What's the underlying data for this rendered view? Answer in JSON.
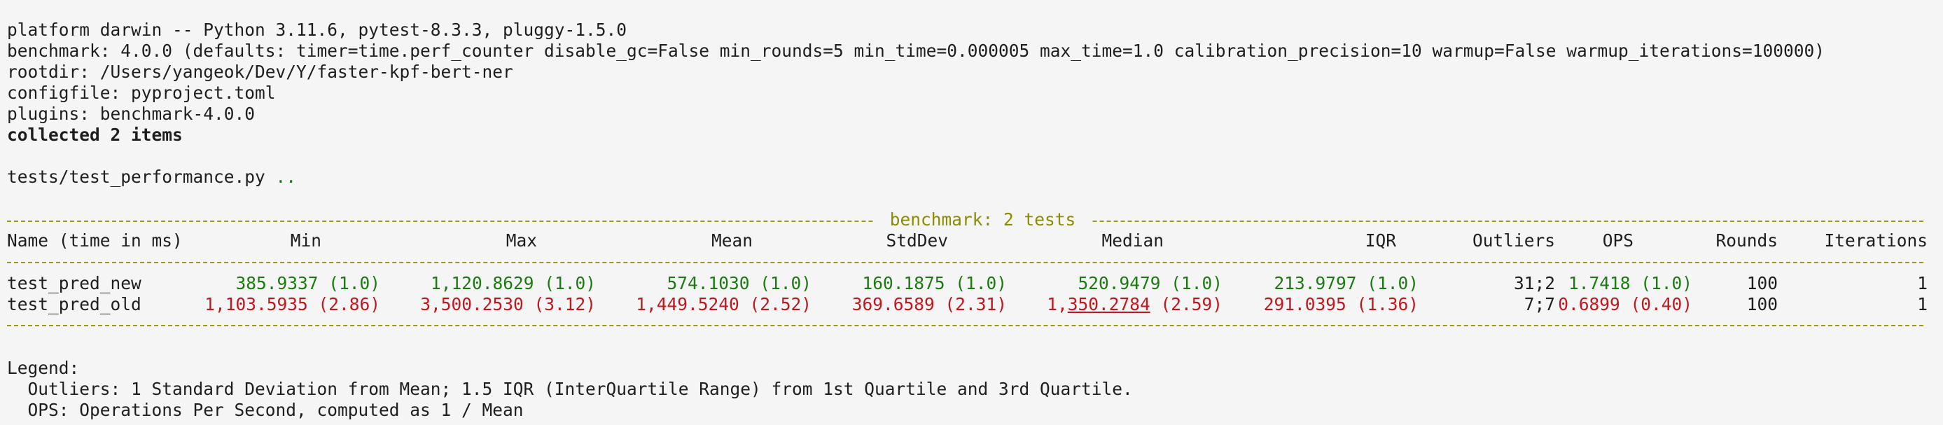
{
  "header": {
    "platform_line": "platform darwin -- Python 3.11.6, pytest-8.3.3, pluggy-1.5.0",
    "benchmark_line": "benchmark: 4.0.0 (defaults: timer=time.perf_counter disable_gc=False min_rounds=5 min_time=0.000005 max_time=1.0 calibration_precision=10 warmup=False warmup_iterations=100000)",
    "rootdir_line": "rootdir: /Users/yangeok/Dev/Y/faster-kpf-bert-ner",
    "configfile_line": "configfile: pyproject.toml",
    "plugins_line": "plugins: benchmark-4.0.0",
    "collected_line": "collected 2 items"
  },
  "test_run": {
    "file": "tests/test_performance.py",
    "result_dots": ".."
  },
  "benchmark_table": {
    "title": " benchmark: 2 tests ",
    "columns": {
      "name": "Name (time in ms)",
      "min": "Min",
      "max": "Max",
      "mean": "Mean",
      "stddev": "StdDev",
      "median": "Median",
      "iqr": "IQR",
      "outliers": "Outliers",
      "ops": "OPS",
      "rounds": "Rounds",
      "iterations": "Iterations"
    },
    "rows": [
      {
        "name": "test_pred_new",
        "min": "385.9337 (1.0)",
        "max": "1,120.8629 (1.0)",
        "mean": "574.1030 (1.0)",
        "stddev": "160.1875 (1.0)",
        "median": "520.9479 (1.0)",
        "iqr": "213.9797 (1.0)",
        "outliers": "31;2",
        "ops": "1.7418 (1.0)",
        "rounds": "100",
        "iterations": "1"
      },
      {
        "name": "test_pred_old",
        "min": "1,103.5935 (2.86)",
        "max": "3,500.2530 (3.12)",
        "mean": "1,449.5240 (2.52)",
        "stddev": "369.6589 (2.31)",
        "median_a": "1,",
        "median_b": "350.2784",
        "median_c": " (2.59)",
        "iqr": "291.0395 (1.36)",
        "outliers": "7;7",
        "ops": "0.6899 (0.40)",
        "rounds": "100",
        "iterations": "1"
      }
    ]
  },
  "legend": {
    "title": "Legend:",
    "outliers": "  Outliers: 1 Standard Deviation from Mean; 1.5 IQR (InterQuartile Range) from 1st Quartile and 3rd Quartile.",
    "ops": "  OPS: Operations Per Second, computed as 1 / Mean"
  },
  "colors": {
    "background": "#f5f5f5",
    "text": "#1e1e1e",
    "best": "#1c7a12",
    "worst": "#c4171d",
    "separator": "#8c8c00"
  }
}
